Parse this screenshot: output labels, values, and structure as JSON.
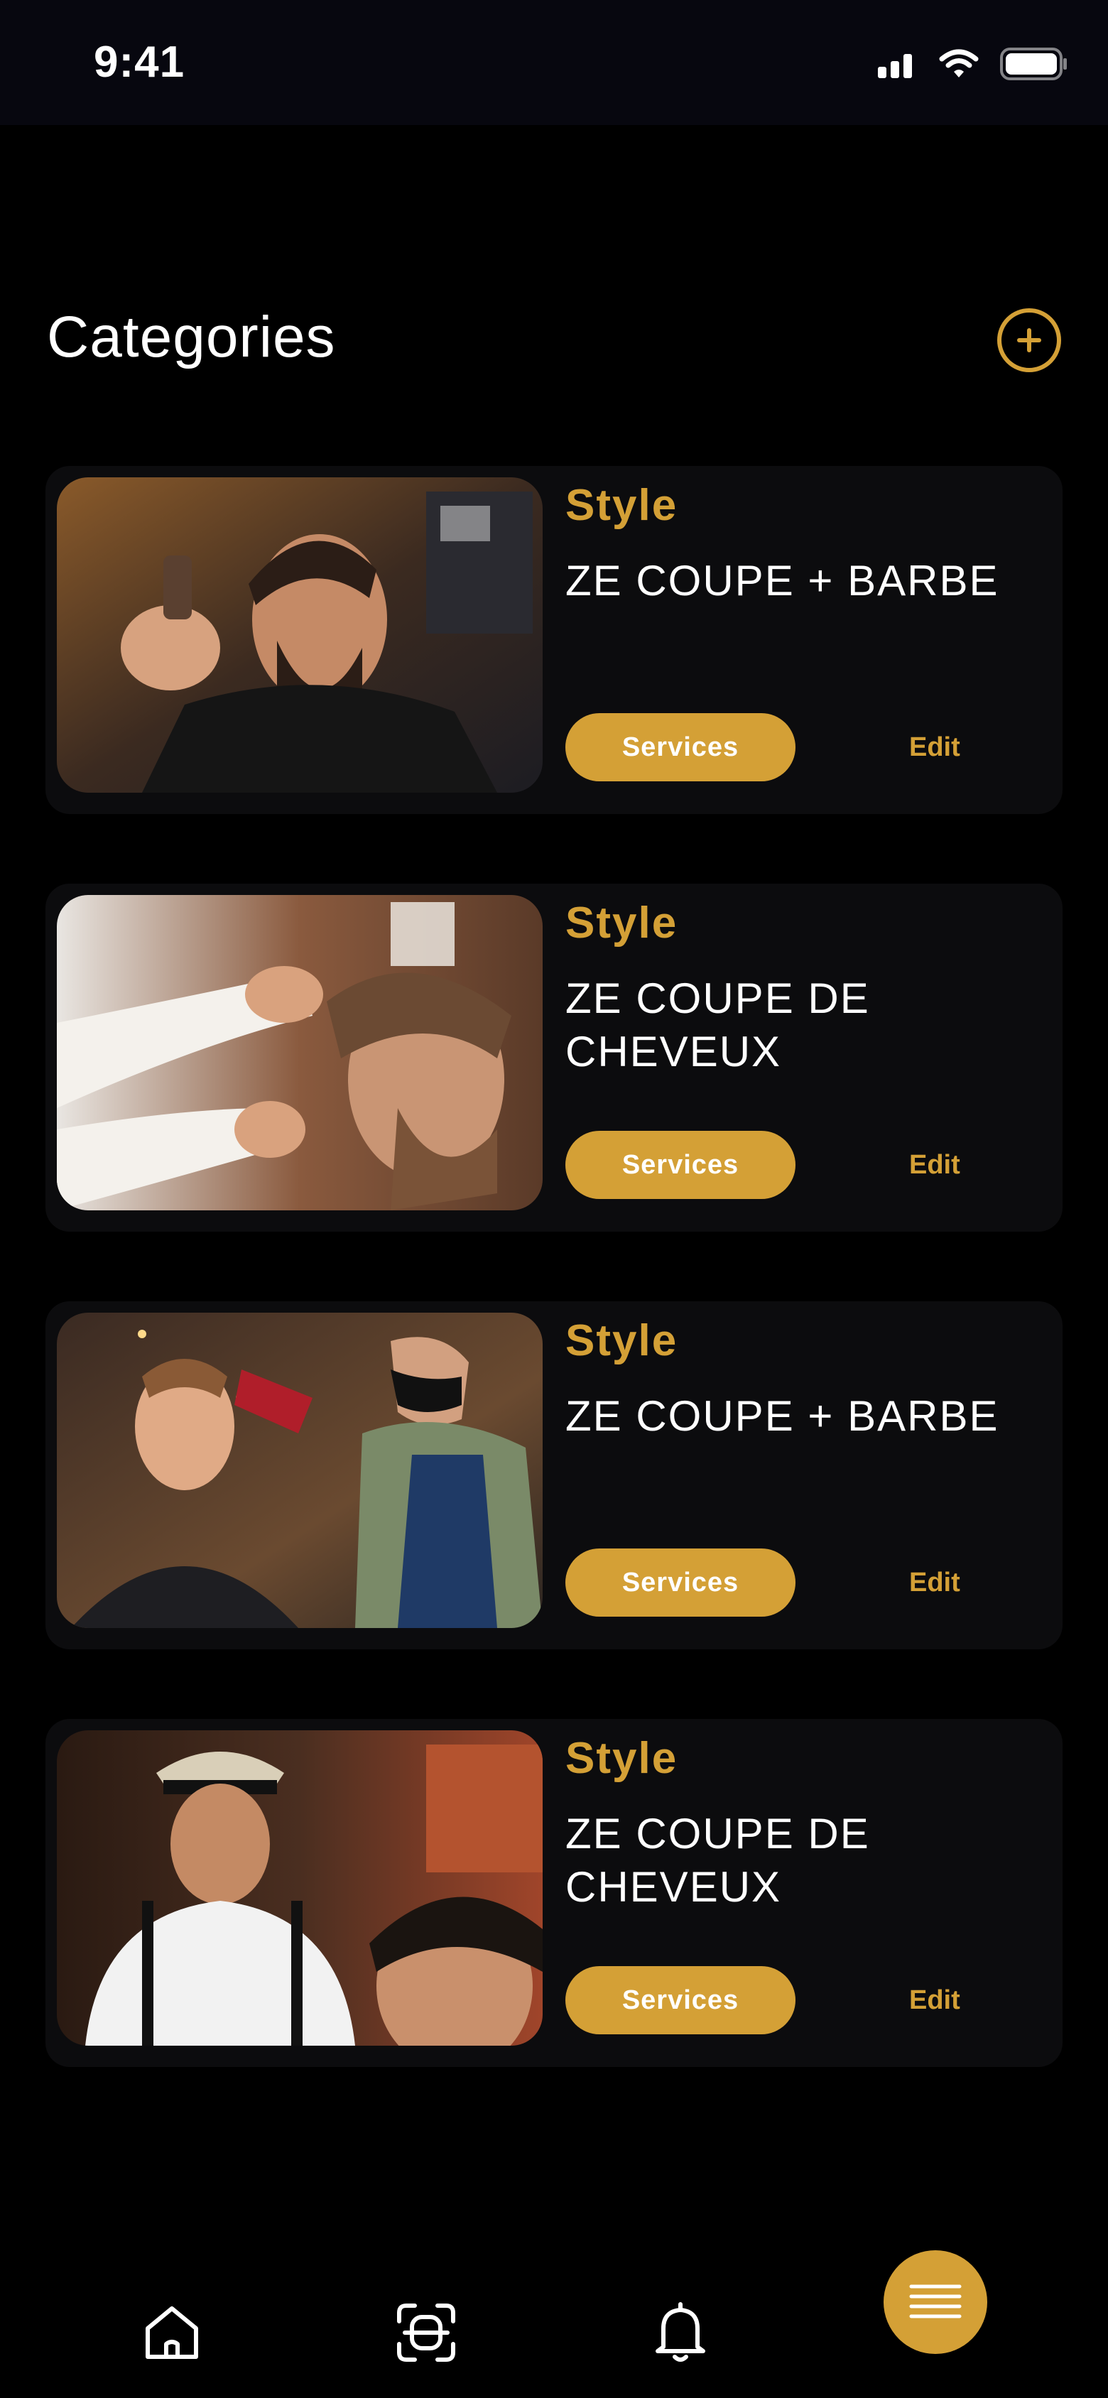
{
  "status_bar": {
    "time": "9:41"
  },
  "header": {
    "title": "Categories"
  },
  "colors": {
    "accent": "#d4a036",
    "background": "#000000",
    "card": "#0c0c0e"
  },
  "categories": [
    {
      "label": "Style",
      "title": "ZE COUPE + BARBE",
      "services_label": "Services",
      "edit_label": "Edit"
    },
    {
      "label": "Style",
      "title": "ZE COUPE DE CHEVEUX",
      "services_label": "Services",
      "edit_label": "Edit"
    },
    {
      "label": "Style",
      "title": "ZE COUPE + BARBE",
      "services_label": "Services",
      "edit_label": "Edit"
    },
    {
      "label": "Style",
      "title": "ZE COUPE DE CHEVEUX",
      "services_label": "Services",
      "edit_label": "Edit"
    }
  ],
  "bottom_nav": {
    "items": [
      "home-icon",
      "scan-icon",
      "bell-icon",
      "menu-icon"
    ]
  }
}
